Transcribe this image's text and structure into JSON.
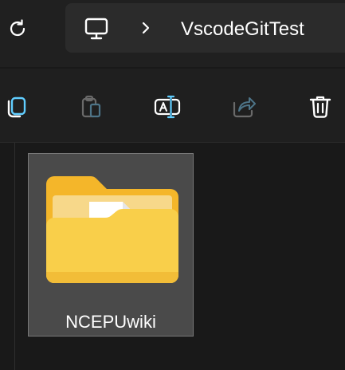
{
  "address": {
    "root_icon": "pc-icon",
    "breadcrumb": [
      "VscodeGitTest"
    ]
  },
  "toolbar": {
    "items": [
      {
        "name": "copy",
        "icon": "copy-icon",
        "enabled": true,
        "accent": "#60cdff"
      },
      {
        "name": "paste",
        "icon": "paste-icon",
        "enabled": false
      },
      {
        "name": "rename",
        "icon": "rename-icon",
        "enabled": true,
        "accent": "#60cdff"
      },
      {
        "name": "share",
        "icon": "share-icon",
        "enabled": false
      },
      {
        "name": "delete",
        "icon": "delete-icon",
        "enabled": true
      }
    ]
  },
  "files": [
    {
      "name": "NCEPUwiki",
      "type": "folder",
      "selected": true
    }
  ],
  "colors": {
    "folder_front": "#f9cf4a",
    "folder_back": "#f4b62a",
    "accent": "#60cdff",
    "selected_tile": "#4a4a4a"
  }
}
